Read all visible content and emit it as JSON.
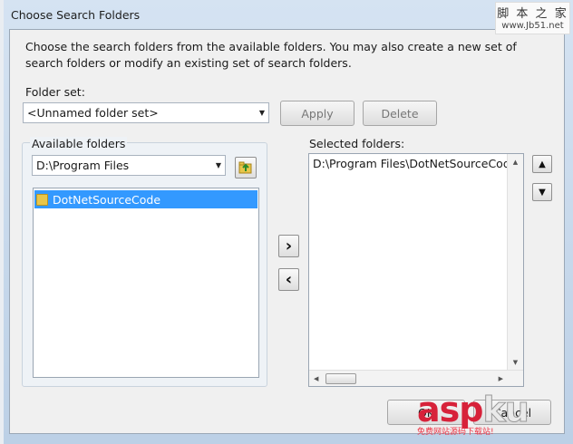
{
  "window": {
    "title": "Choose Search Folders"
  },
  "description": "Choose the search folders from the available folders. You may also create a new set of search folders or modify an existing set of search folders.",
  "folder_set": {
    "label": "Folder set:",
    "value": "<Unnamed folder set>",
    "apply_label": "Apply",
    "delete_label": "Delete"
  },
  "available": {
    "label": "Available folders",
    "path": "D:\\Program Files",
    "items": [
      {
        "name": "DotNetSourceCode",
        "selected": true
      }
    ]
  },
  "selected": {
    "label": "Selected folders:",
    "items": [
      "D:\\Program Files\\DotNetSourceCode"
    ]
  },
  "buttons": {
    "add_glyph": "›",
    "remove_glyph": "‹",
    "up_glyph": "▲",
    "down_glyph": "▼",
    "ok_label": "OK",
    "cancel_label": "Cancel"
  },
  "watermark": {
    "line1": "脚 本 之 家",
    "line2": "www.Jb51.net",
    "logo_a": "asp",
    "logo_b": "ku",
    "tagline": "免费网站源码下载站!"
  },
  "icons": {
    "combo_arrow": "▼",
    "folder_up": "folder-up-icon",
    "folder": "folder-icon"
  }
}
